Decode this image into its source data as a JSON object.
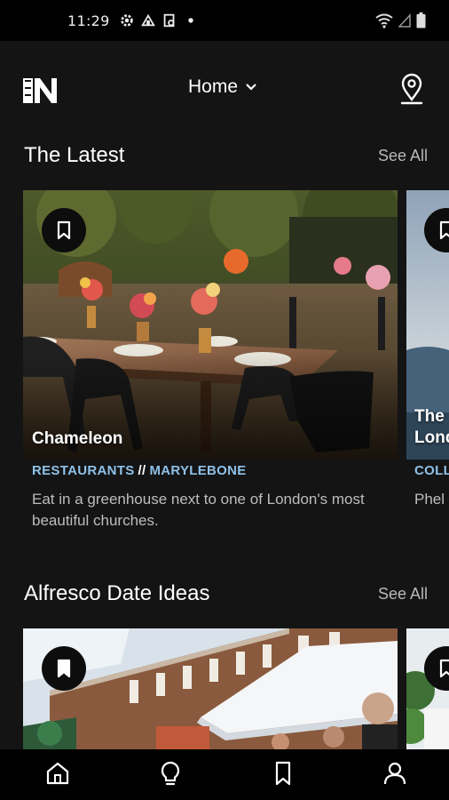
{
  "status_bar": {
    "time": "11:29"
  },
  "header": {
    "title": "Home",
    "logo_text": "THE N"
  },
  "sections": [
    {
      "title": "The Latest",
      "see_all": "See All",
      "cards": [
        {
          "title": "Chameleon",
          "category": "RESTAURANTS",
          "separator": "//",
          "area": "MARYLEBONE",
          "description": "Eat in a greenhouse next to one of London's most beautiful churches."
        },
        {
          "title": "The Lond",
          "category": "COLL",
          "description": "Phel"
        }
      ]
    },
    {
      "title": "Alfresco Date Ideas",
      "see_all": "See All"
    }
  ],
  "icons": {
    "status": [
      "gear-icon",
      "tools-icon",
      "screenshot-icon",
      "dot-icon",
      "wifi-icon",
      "signal-icon",
      "battery-icon"
    ],
    "header": [
      "logo-icon",
      "chevron-down-icon",
      "location-pin-icon"
    ],
    "card": [
      "bookmark-icon"
    ],
    "bottom_nav": [
      "home-icon",
      "lightbulb-icon",
      "bookmark-icon",
      "profile-icon"
    ]
  },
  "colors": {
    "background": "#141414",
    "category": "#8fc1e8",
    "bar": "#000000"
  }
}
